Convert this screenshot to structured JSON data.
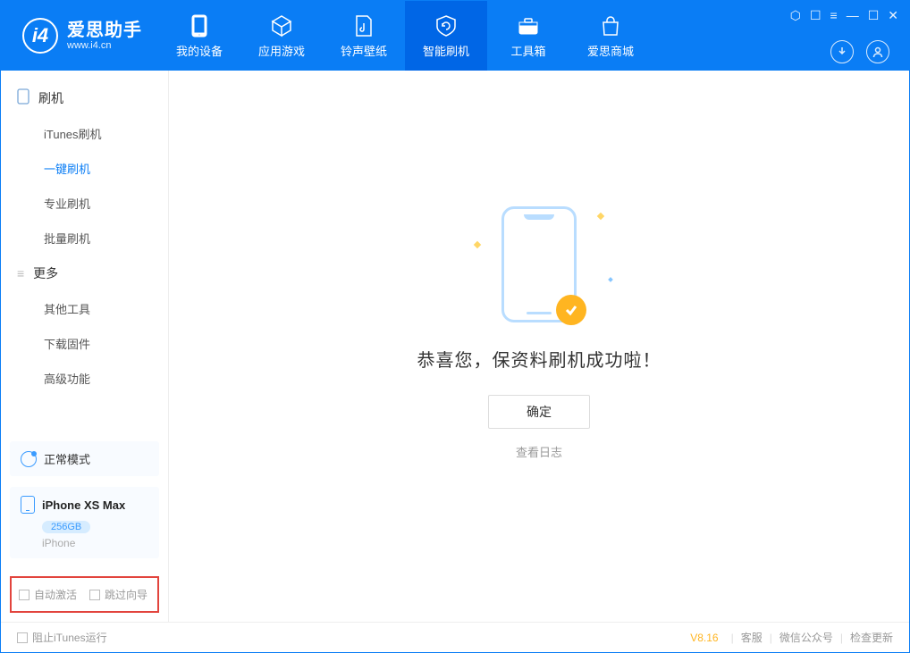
{
  "brand": {
    "title": "爱思助手",
    "sub": "www.i4.cn",
    "logo_letter": "i4"
  },
  "nav": {
    "items": [
      {
        "label": "我的设备"
      },
      {
        "label": "应用游戏"
      },
      {
        "label": "铃声壁纸"
      },
      {
        "label": "智能刷机"
      },
      {
        "label": "工具箱"
      },
      {
        "label": "爱思商城"
      }
    ]
  },
  "sidebar": {
    "group1_title": "刷机",
    "group1": [
      {
        "label": "iTunes刷机"
      },
      {
        "label": "一键刷机"
      },
      {
        "label": "专业刷机"
      },
      {
        "label": "批量刷机"
      }
    ],
    "group2_title": "更多",
    "group2": [
      {
        "label": "其他工具"
      },
      {
        "label": "下载固件"
      },
      {
        "label": "高级功能"
      }
    ],
    "mode_label": "正常模式",
    "device": {
      "name": "iPhone XS Max",
      "capacity": "256GB",
      "type": "iPhone"
    },
    "auto_activate": "自动激活",
    "skip_guide": "跳过向导"
  },
  "main": {
    "success_text": "恭喜您，保资料刷机成功啦！",
    "ok_label": "确定",
    "log_link": "查看日志"
  },
  "footer": {
    "stop_itunes": "阻止iTunes运行",
    "version": "V8.16",
    "support": "客服",
    "wechat": "微信公众号",
    "check_update": "检查更新"
  }
}
